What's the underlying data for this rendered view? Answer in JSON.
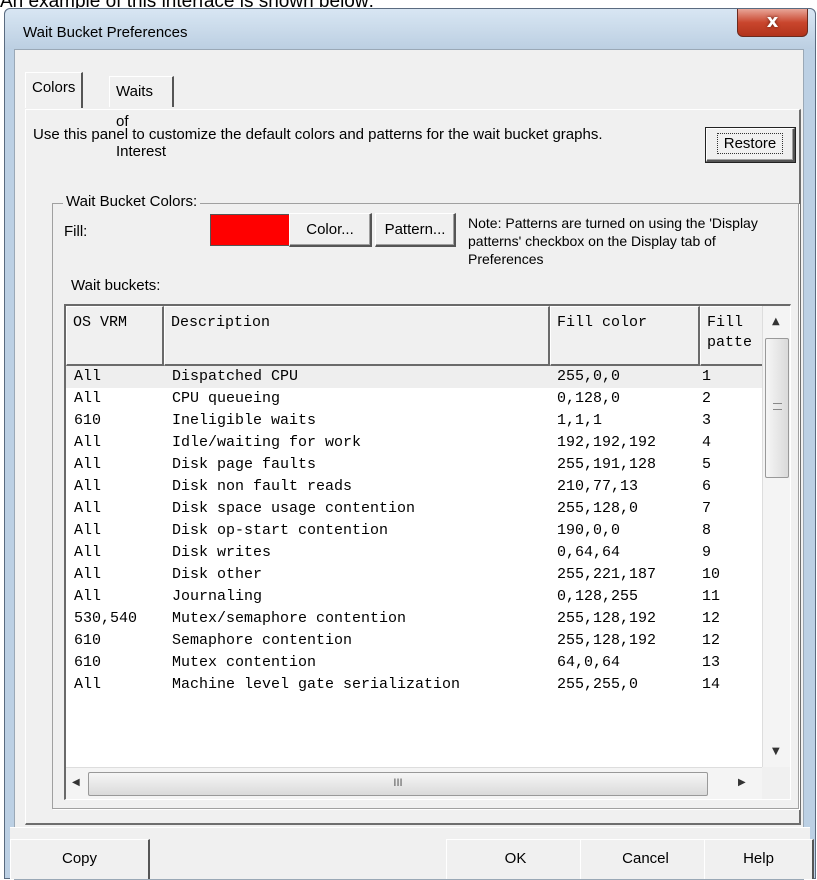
{
  "caption": "An example of this interface is shown below:",
  "window": {
    "title": "Wait Bucket Preferences",
    "close_label": "x"
  },
  "tabs": [
    {
      "label": "Colors",
      "active": true
    },
    {
      "label": "Waits of Interest",
      "active": false
    }
  ],
  "panel": {
    "intro": "Use this panel to customize the default colors and patterns for the wait bucket graphs.",
    "restore_label": "Restore",
    "group_label": "Wait Bucket Colors:",
    "fill_label": "Fill:",
    "fill_color": "#ff0000",
    "color_button": "Color...",
    "pattern_button": "Pattern...",
    "note": "Note: Patterns are turned on using the 'Display patterns' checkbox on the Display tab of Preferences",
    "wait_buckets_label": "Wait buckets:"
  },
  "table": {
    "columns": [
      "OS VRM",
      "Description",
      "Fill color",
      "Fill\npatte"
    ],
    "rows": [
      [
        "All",
        "Dispatched CPU",
        "255,0,0",
        "1"
      ],
      [
        "All",
        "CPU queueing",
        "0,128,0",
        "2"
      ],
      [
        "610",
        "Ineligible waits",
        "1,1,1",
        "3"
      ],
      [
        "All",
        "Idle/waiting for work",
        "192,192,192",
        "4"
      ],
      [
        "All",
        "Disk page faults",
        "255,191,128",
        "5"
      ],
      [
        "All",
        "Disk non fault reads",
        "210,77,13",
        "6"
      ],
      [
        "All",
        "Disk space usage contention",
        "255,128,0",
        "7"
      ],
      [
        "All",
        "Disk op-start contention",
        "190,0,0",
        "8"
      ],
      [
        "All",
        "Disk writes",
        "0,64,64",
        "9"
      ],
      [
        "All",
        "Disk other",
        "255,221,187",
        "10"
      ],
      [
        "All",
        "Journaling",
        "0,128,255",
        "11"
      ],
      [
        "530,540",
        "Mutex/semaphore contention",
        "255,128,192",
        "12"
      ],
      [
        "610",
        "Semaphore contention",
        "255,128,192",
        "12"
      ],
      [
        "610",
        "Mutex contention",
        "64,0,64",
        "13"
      ],
      [
        "All",
        "Machine level gate serialization",
        "255,255,0",
        "14"
      ]
    ],
    "selected_row": 0,
    "hscroll_thumb": "III"
  },
  "buttons": {
    "copy": "Copy",
    "ok": "OK",
    "cancel": "Cancel",
    "help": "Help"
  }
}
